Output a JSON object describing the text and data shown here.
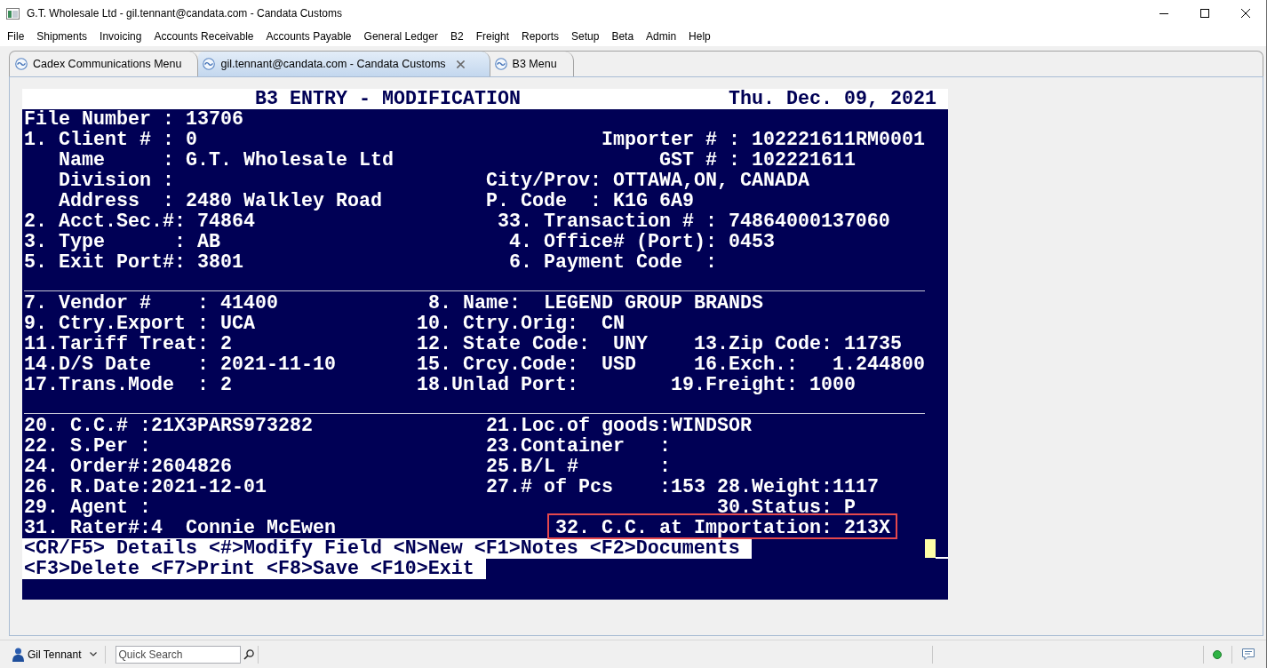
{
  "window": {
    "title": "G.T. Wholesale Ltd - gil.tennant@candata.com - Candata Customs"
  },
  "menu": [
    "File",
    "Shipments",
    "Invoicing",
    "Accounts Receivable",
    "Accounts Payable",
    "General Ledger",
    "B2",
    "Freight",
    "Reports",
    "Setup",
    "Beta",
    "Admin",
    "Help"
  ],
  "tabs": [
    {
      "label": "Cadex Communications Menu",
      "selected": false,
      "closable": false
    },
    {
      "label": "gil.tennant@candata.com - Candata Customs",
      "selected": true,
      "closable": true
    },
    {
      "label": "B3 Menu",
      "selected": false,
      "closable": false
    }
  ],
  "terminal": {
    "rows": [
      {
        "kind": "header",
        "segments": [
          {
            "text": "B3 ENTRY - MODIFICATION",
            "highlighted": false
          },
          {
            "text": "Thu. Dec. 09, 2021",
            "highlighted": false
          }
        ]
      },
      {
        "kind": "text",
        "segments": [
          {
            "text": "File Number : 13706",
            "highlighted": false
          }
        ]
      },
      {
        "kind": "text",
        "segments": [
          {
            "text": "1. Client # : 0",
            "highlighted": false
          },
          {
            "text": "Importer # : 102221611RM0001",
            "highlighted": false
          }
        ]
      },
      {
        "kind": "text",
        "segments": [
          {
            "text": "Name     : G.T. Wholesale Ltd",
            "highlighted": false
          },
          {
            "text": "GST # : 102221611",
            "highlighted": false
          }
        ]
      },
      {
        "kind": "text",
        "segments": [
          {
            "text": "Division :",
            "highlighted": false
          },
          {
            "text": "City/Prov: OTTAWA,ON, CANADA",
            "highlighted": false
          }
        ]
      },
      {
        "kind": "text",
        "segments": [
          {
            "text": "Address  : 2480 Walkley Road",
            "highlighted": false
          },
          {
            "text": "P. Code  : K1G 6A9",
            "highlighted": false
          }
        ]
      },
      {
        "kind": "text",
        "segments": [
          {
            "text": "2. Acct.Sec.#: 74864",
            "highlighted": false
          },
          {
            "text": "33. Transaction # : 74864000137060",
            "highlighted": false
          }
        ]
      },
      {
        "kind": "text",
        "segments": [
          {
            "text": "3. Type      : AB",
            "highlighted": false
          },
          {
            "text": "4. Office# (Port): 0453",
            "highlighted": false
          }
        ]
      },
      {
        "kind": "text",
        "segments": [
          {
            "text": "5. Exit Port#: 3801",
            "highlighted": false
          },
          {
            "text": "6. Payment Code  :",
            "highlighted": false
          }
        ]
      },
      {
        "kind": "rule"
      },
      {
        "kind": "text",
        "segments": [
          {
            "text": "7. Vendor #    : 41400",
            "highlighted": false
          },
          {
            "text": "8. Name:  LEGEND GROUP BRANDS",
            "highlighted": false
          }
        ]
      },
      {
        "kind": "text",
        "segments": [
          {
            "text": "9. Ctry.Export : UCA",
            "highlighted": false
          },
          {
            "text": "10. Ctry.Orig:  CN",
            "highlighted": false
          }
        ]
      },
      {
        "kind": "text",
        "segments": [
          {
            "text": "11.Tariff Treat: 2",
            "highlighted": false
          },
          {
            "text": "12. State Code:  UNY",
            "highlighted": false
          },
          {
            "text": "13.Zip Code: 11735",
            "highlighted": false
          }
        ]
      },
      {
        "kind": "text",
        "segments": [
          {
            "text": "14.D/S Date    : 2021-11-10",
            "highlighted": false
          },
          {
            "text": "15. Crcy.Code:  USD",
            "highlighted": false
          },
          {
            "text": "16.Exch.:   1.244800",
            "highlighted": false
          }
        ]
      },
      {
        "kind": "text",
        "segments": [
          {
            "text": "17.Trans.Mode  : 2",
            "highlighted": false
          },
          {
            "text": "18.Unlad Port:",
            "highlighted": false
          },
          {
            "text": "19.Freight: 1000",
            "highlighted": false
          }
        ]
      },
      {
        "kind": "rule"
      },
      {
        "kind": "text",
        "segments": [
          {
            "text": "20. C.C.# :21X3PARS973282",
            "highlighted": false
          },
          {
            "text": "21.Loc.of goods:WINDSOR",
            "highlighted": false
          }
        ]
      },
      {
        "kind": "text",
        "segments": [
          {
            "text": "22. S.Per :",
            "highlighted": false
          },
          {
            "text": "23.Container   :",
            "highlighted": false
          }
        ]
      },
      {
        "kind": "text",
        "segments": [
          {
            "text": "24. Order#:2604826",
            "highlighted": false
          },
          {
            "text": "25.B/L #       :",
            "highlighted": false
          }
        ]
      },
      {
        "kind": "text",
        "segments": [
          {
            "text": "26. R.Date:2021-12-01",
            "highlighted": false
          },
          {
            "text": "27.# of Pcs    :153",
            "highlighted": false
          },
          {
            "text": "28.Weight:1117",
            "highlighted": false
          }
        ]
      },
      {
        "kind": "text",
        "segments": [
          {
            "text": "29. Agent :",
            "highlighted": false
          },
          {
            "text": "30.Status: P",
            "highlighted": false
          }
        ]
      },
      {
        "kind": "text",
        "segments": [
          {
            "text": "31. Rater#:4  Connie McEwen",
            "highlighted": false
          },
          {
            "text": "32. C.C. at Importation: 213X",
            "highlighted": true
          }
        ]
      },
      {
        "kind": "command",
        "segments": [
          {
            "text": "<CR/F5> Details <#>Modify Field <N>New <F1>Notes <F2>Documents",
            "highlighted": false
          }
        ]
      },
      {
        "kind": "command",
        "segments": [
          {
            "text": "<F3>Delete <F7>Print <F8>Save <F10>Exit",
            "highlighted": false
          }
        ]
      },
      {
        "kind": "blank"
      }
    ]
  },
  "status_bar": {
    "user": "Gil Tennant",
    "search": {
      "placeholder": "Quick Search"
    },
    "connected": true
  }
}
